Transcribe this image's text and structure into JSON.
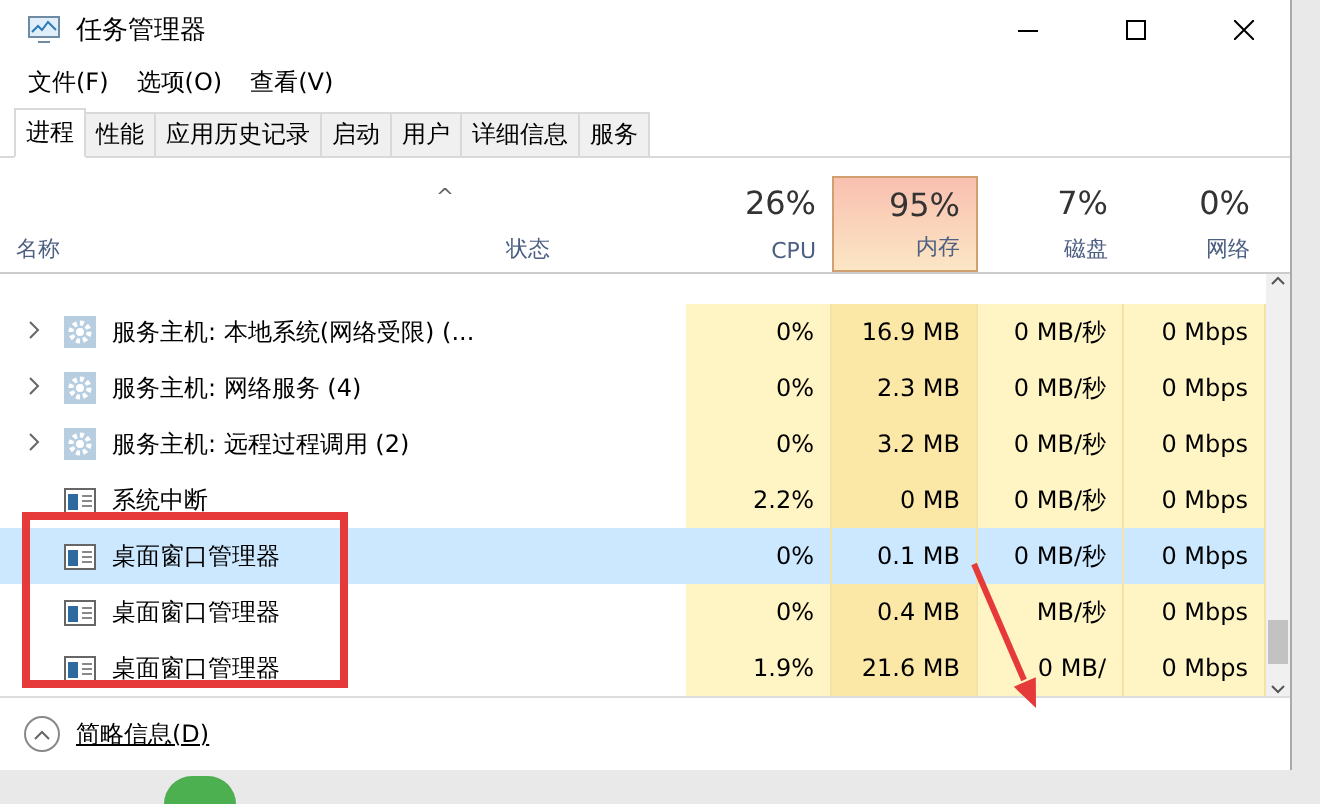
{
  "window": {
    "title": "任务管理器"
  },
  "menu": [
    "文件(F)",
    "选项(O)",
    "查看(V)"
  ],
  "tabs": [
    {
      "label": "进程",
      "selected": true
    },
    {
      "label": "性能",
      "selected": false
    },
    {
      "label": "应用历史记录",
      "selected": false
    },
    {
      "label": "启动",
      "selected": false
    },
    {
      "label": "用户",
      "selected": false
    },
    {
      "label": "详细信息",
      "selected": false
    },
    {
      "label": "服务",
      "selected": false
    }
  ],
  "table": {
    "sort_arrow": "^",
    "columns": [
      {
        "kind": "name",
        "label": "名称"
      },
      {
        "kind": "status",
        "label": "状态"
      },
      {
        "kind": "metric",
        "total": "26%",
        "label": "CPU",
        "alert": false
      },
      {
        "kind": "metric",
        "total": "95%",
        "label": "内存",
        "alert": true
      },
      {
        "kind": "metric",
        "total": "7%",
        "label": "磁盘",
        "alert": false
      },
      {
        "kind": "metric",
        "total": "0%",
        "label": "网络",
        "alert": false
      }
    ],
    "rows": [
      {
        "kind": "service",
        "expandable": true,
        "selected": false,
        "cells": [
          "服务主机: 本地系统(网络受限) (...",
          "",
          "0%",
          "16.9 MB",
          "0 MB/秒",
          "0 Mbps"
        ]
      },
      {
        "kind": "service",
        "expandable": true,
        "selected": false,
        "cells": [
          "服务主机: 网络服务 (4)",
          "",
          "0%",
          "2.3 MB",
          "0 MB/秒",
          "0 Mbps"
        ]
      },
      {
        "kind": "service",
        "expandable": true,
        "selected": false,
        "cells": [
          "服务主机: 远程过程调用 (2)",
          "",
          "0%",
          "3.2 MB",
          "0 MB/秒",
          "0 Mbps"
        ]
      },
      {
        "kind": "app",
        "expandable": false,
        "selected": false,
        "cells": [
          "系统中断",
          "",
          "2.2%",
          "0 MB",
          "0 MB/秒",
          "0 Mbps"
        ]
      },
      {
        "kind": "app",
        "expandable": false,
        "selected": true,
        "cells": [
          "桌面窗口管理器",
          "",
          "0%",
          "0.1 MB",
          "0 MB/秒",
          "0 Mbps"
        ]
      },
      {
        "kind": "app",
        "expandable": false,
        "selected": false,
        "cells": [
          "桌面窗口管理器",
          "",
          "0%",
          "0.4 MB",
          "MB/秒",
          "0 Mbps"
        ]
      },
      {
        "kind": "app",
        "expandable": false,
        "selected": false,
        "cells": [
          "桌面窗口管理器",
          "",
          "1.9%",
          "21.6 MB",
          "0 MB/",
          "0 Mbps"
        ]
      }
    ]
  },
  "footer": {
    "label": "简略信息(D)"
  }
}
